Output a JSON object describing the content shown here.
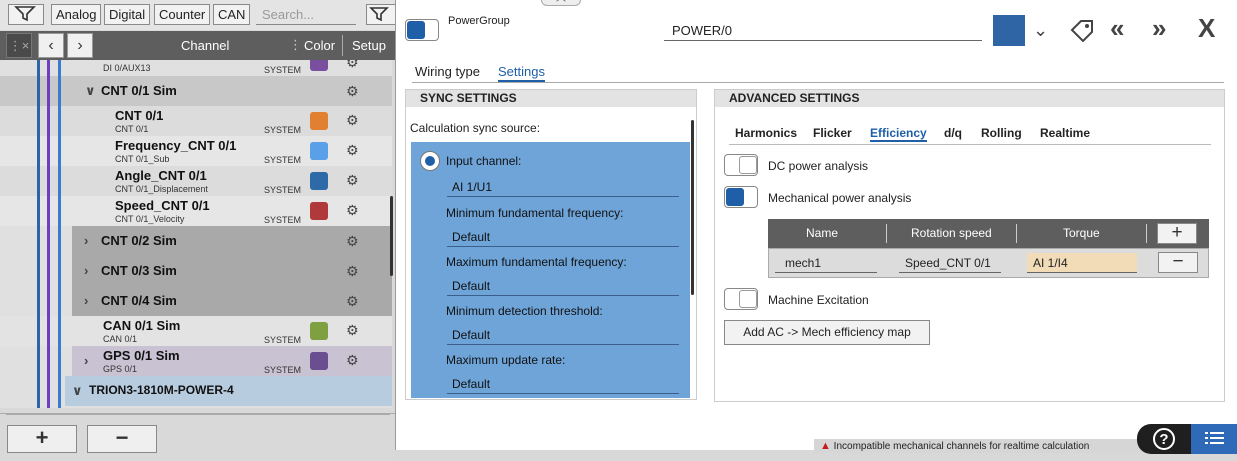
{
  "filterbar": {
    "buttons": [
      "Analog",
      "Digital",
      "Counter",
      "CAN"
    ],
    "search_placeholder": "Search..."
  },
  "table": {
    "headers": {
      "channel": "Channel",
      "color": "Color",
      "setup": "Setup"
    }
  },
  "rows": [
    {
      "name": "",
      "sub": "DI 0/AUX13",
      "sys": "SYSTEM",
      "color": "#7b4fa0"
    },
    {
      "name": "CNT 0/1 Sim",
      "sub": "",
      "sys": "",
      "color": ""
    },
    {
      "name": "CNT 0/1",
      "sub": "CNT 0/1",
      "sys": "SYSTEM",
      "color": "#e08030"
    },
    {
      "name": "Frequency_CNT 0/1",
      "sub": "CNT 0/1_Sub",
      "sys": "SYSTEM",
      "color": "#5aa0e8"
    },
    {
      "name": "Angle_CNT 0/1",
      "sub": "CNT 0/1_Displacement",
      "sys": "SYSTEM",
      "color": "#2f6aa8"
    },
    {
      "name": "Speed_CNT 0/1",
      "sub": "CNT 0/1_Velocity",
      "sys": "SYSTEM",
      "color": "#b03a3a"
    },
    {
      "name": "CNT 0/2 Sim",
      "sub": "",
      "sys": "",
      "color": ""
    },
    {
      "name": "CNT 0/3 Sim",
      "sub": "",
      "sys": "",
      "color": ""
    },
    {
      "name": "CNT 0/4 Sim",
      "sub": "",
      "sys": "",
      "color": ""
    },
    {
      "name": "CAN 0/1 Sim",
      "sub": "CAN 0/1",
      "sys": "SYSTEM",
      "color": "#7ea040"
    },
    {
      "name": "GPS 0/1 Sim",
      "sub": "GPS 0/1",
      "sys": "SYSTEM",
      "color": "#6a4f90"
    },
    {
      "name": "TRION3-1810M-POWER-4",
      "sub": "",
      "sys": "",
      "color": ""
    }
  ],
  "bottom": {
    "add": "+",
    "remove": "−"
  },
  "dialog": {
    "group_label": "PowerGroup",
    "name_value": "POWER/0",
    "color": "#2f65a5",
    "tabs": [
      "Wiring type",
      "Settings"
    ],
    "active_tab": "Settings",
    "sync": {
      "heading": "SYNC SETTINGS",
      "source_label": "Calculation sync source:",
      "input_channel_label": "Input channel:",
      "input_channel_value": "AI 1/U1",
      "min_freq_label": "Minimum fundamental frequency:",
      "min_freq_value": "Default",
      "max_freq_label": "Maximum fundamental frequency:",
      "max_freq_value": "Default",
      "min_det_label": "Minimum detection threshold:",
      "min_det_value": "Default",
      "max_upd_label": "Maximum update rate:",
      "max_upd_value": "Default"
    },
    "advanced": {
      "heading": "ADVANCED SETTINGS",
      "tabs": [
        "Harmonics",
        "Flicker",
        "Efficiency",
        "d/q",
        "Rolling",
        "Realtime"
      ],
      "active_tab": "Efficiency",
      "dc_label": "DC power analysis",
      "mech_label": "Mechanical power analysis",
      "grid_headers": [
        "Name",
        "Rotation speed",
        "Torque"
      ],
      "grid_row": {
        "name": "mech1",
        "rotation": "Speed_CNT 0/1",
        "torque": "AI 1/I4"
      },
      "excitation_label": "Machine Excitation",
      "map_button": "Add AC -> Mech efficiency map"
    },
    "warning": "Incompatible mechanical channels for realtime calculation",
    "help": "?"
  }
}
